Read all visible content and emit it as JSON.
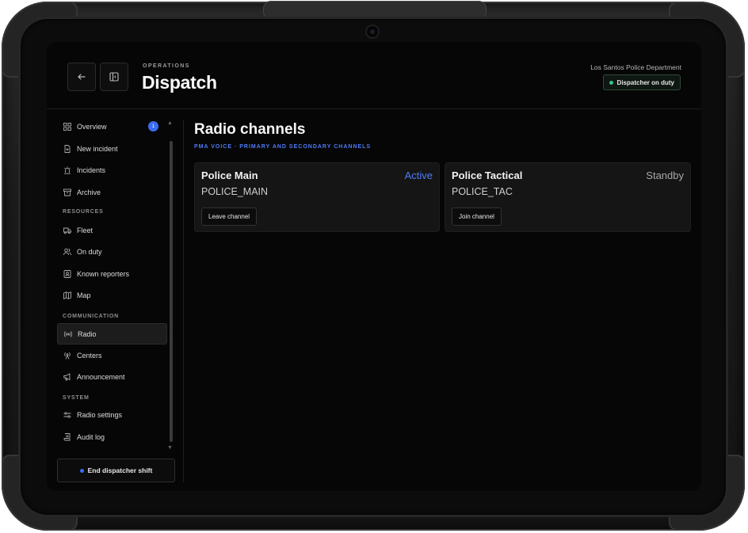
{
  "header": {
    "eyebrow": "OPERATIONS",
    "title": "Dispatch",
    "department": "Los Santos Police Department",
    "duty_badge": "Dispatcher on duty"
  },
  "sidebar": {
    "items": [
      {
        "label": "Overview",
        "icon": "grid-icon",
        "badge": "1"
      },
      {
        "label": "New incident",
        "icon": "file-plus-icon"
      },
      {
        "label": "Incidents",
        "icon": "siren-icon"
      },
      {
        "label": "Archive",
        "icon": "archive-icon"
      },
      {
        "label": "Fleet",
        "icon": "truck-icon"
      },
      {
        "label": "On duty",
        "icon": "users-icon"
      },
      {
        "label": "Known reporters",
        "icon": "contact-icon"
      },
      {
        "label": "Map",
        "icon": "map-icon"
      },
      {
        "label": "Radio",
        "icon": "radio-waves-icon",
        "active": true
      },
      {
        "label": "Centers",
        "icon": "antenna-icon"
      },
      {
        "label": "Announcement",
        "icon": "megaphone-icon"
      },
      {
        "label": "Radio settings",
        "icon": "sliders-icon"
      },
      {
        "label": "Audit log",
        "icon": "scroll-icon"
      }
    ],
    "sections": {
      "resources": "RESOURCES",
      "communication": "COMMUNICATION",
      "system": "SYSTEM"
    },
    "end_shift": "End dispatcher shift"
  },
  "main": {
    "title": "Radio channels",
    "subtitle": "PMA VOICE · PRIMARY AND SECONDARY CHANNELS",
    "channels": [
      {
        "name": "Police Main",
        "status": "Active",
        "code": "POLICE_MAIN",
        "action": "Leave channel"
      },
      {
        "name": "Police Tactical",
        "status": "Standby",
        "code": "POLICE_TAC",
        "action": "Join channel"
      }
    ]
  },
  "colors": {
    "accent": "#4f7cf7",
    "active_status": "#4f7cf7",
    "standby_status": "#a8a8a8",
    "on_duty": "#31c48d"
  }
}
